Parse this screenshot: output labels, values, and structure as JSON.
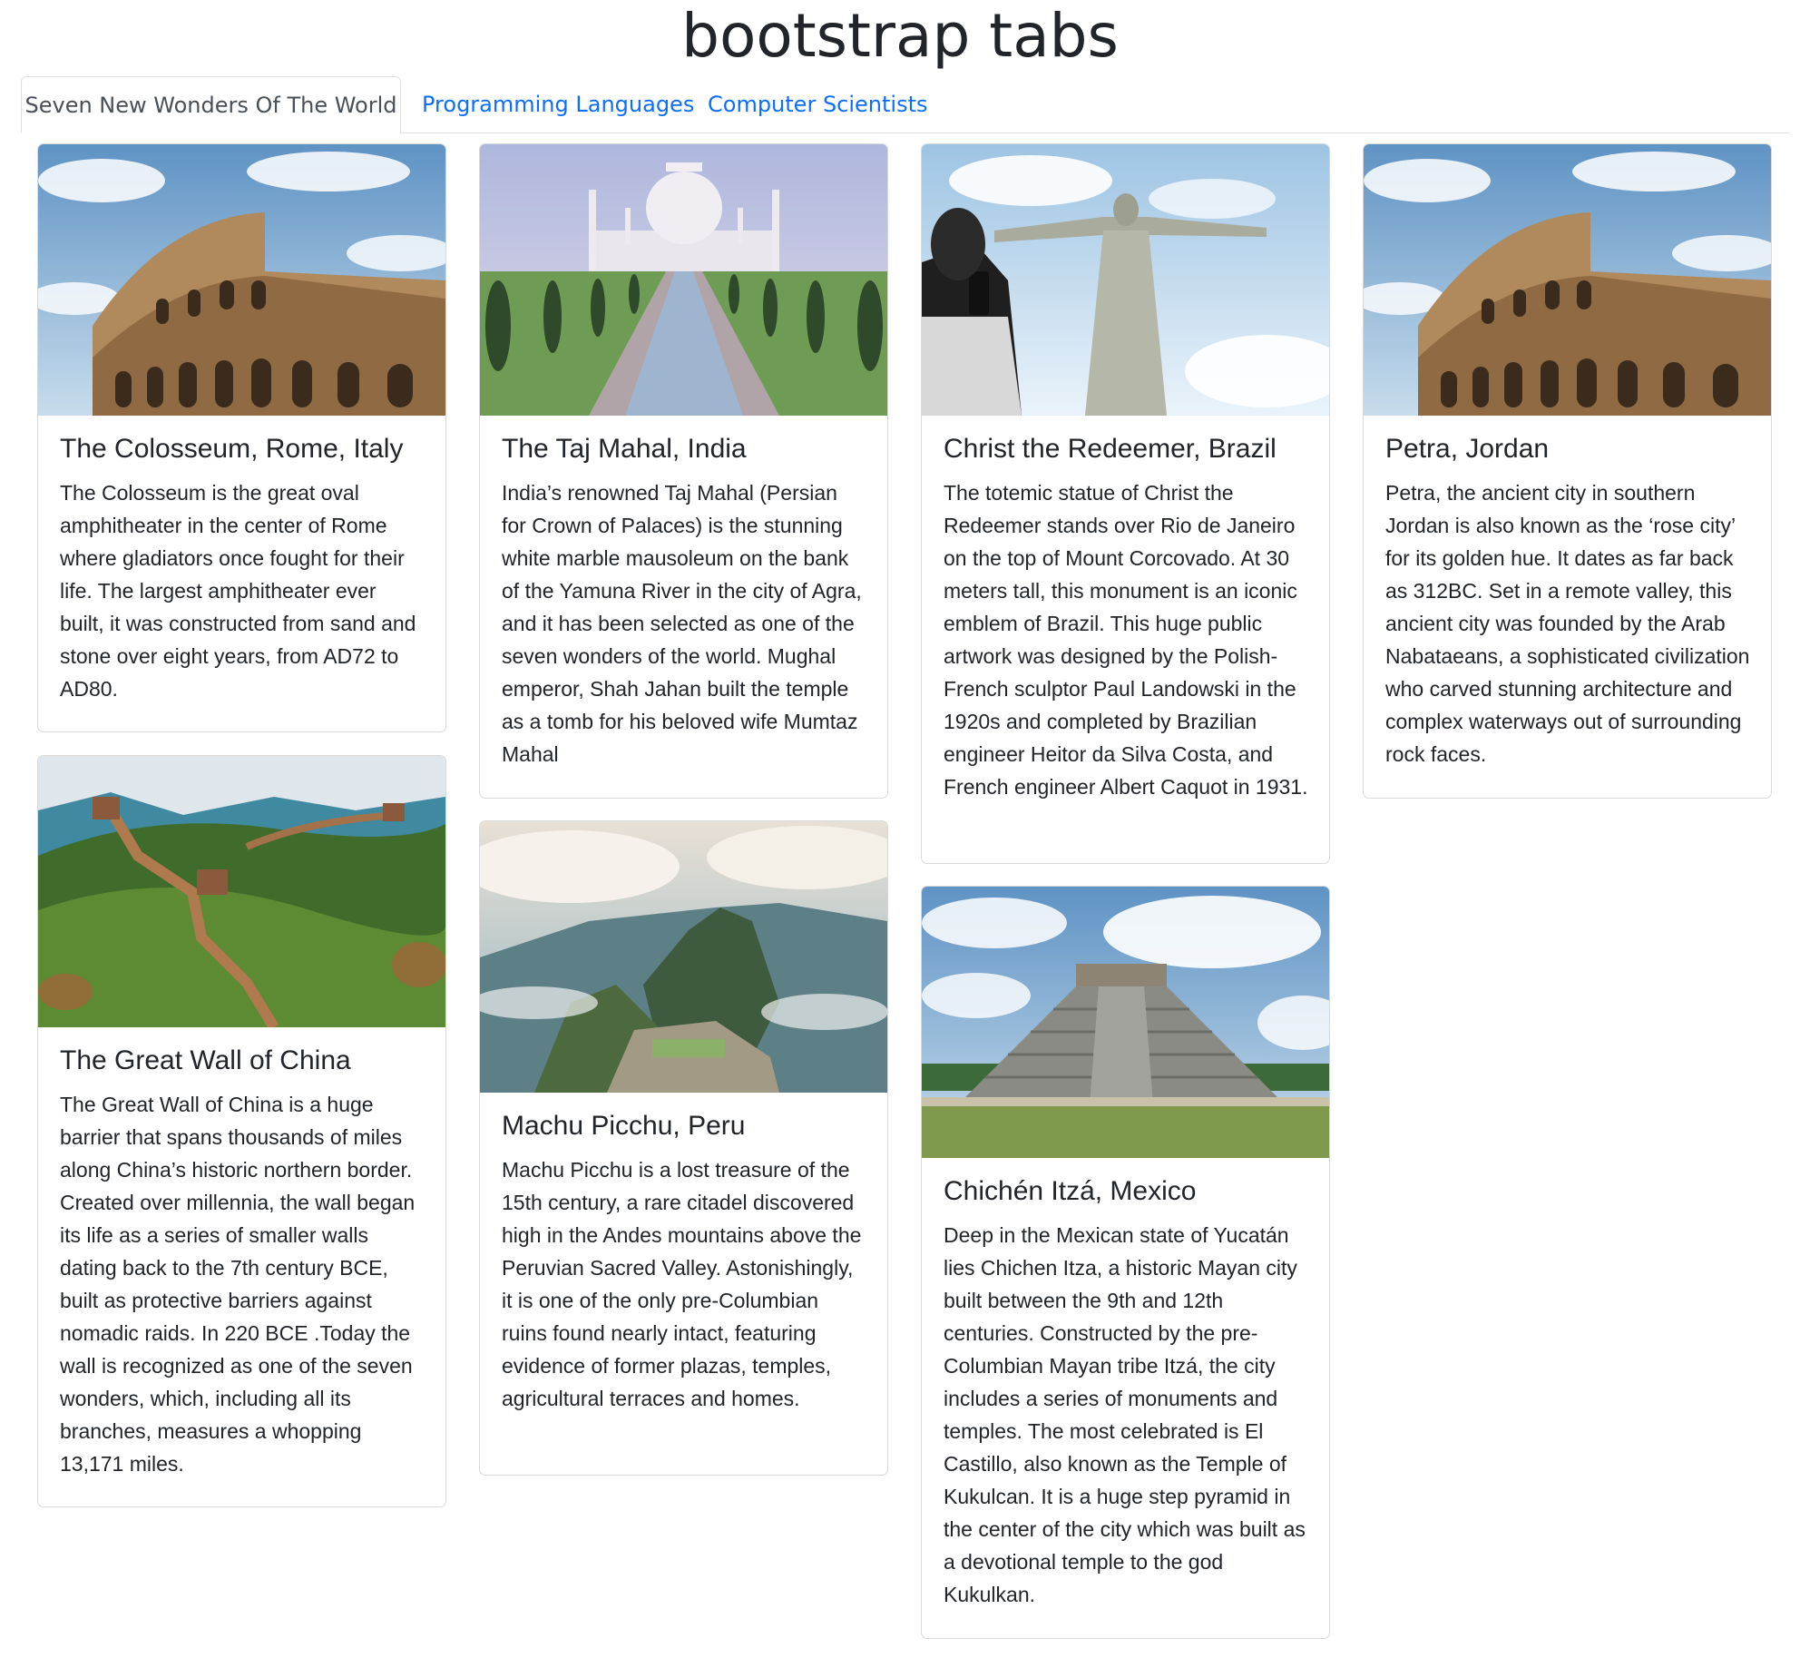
{
  "page": {
    "title": "bootstrap tabs"
  },
  "tabs": [
    {
      "label": "Seven New Wonders Of The World",
      "active": true
    },
    {
      "label": "Programming Languages",
      "active": false
    },
    {
      "label": "Computer Scientists",
      "active": false
    }
  ],
  "cards": [
    {
      "image_icon": "colosseum-photo",
      "title": "The Colosseum, Rome, Italy",
      "text": "The Colosseum is the great oval amphitheater in the center of Rome where gladiators once fought for their life. The largest amphitheater ever built, it was constructed from sand and stone over eight years, from AD72 to AD80."
    },
    {
      "image_icon": "taj-mahal-photo",
      "title": "The Taj Mahal, India",
      "text": "India’s renowned Taj Mahal (Persian for Crown of Palaces) is the stunning white marble mausoleum on the bank of the Yamuna River in the city of Agra, and it has been selected as one of the seven wonders of the world. Mughal emperor, Shah Jahan built the temple as a tomb for his beloved wife Mumtaz Mahal"
    },
    {
      "image_icon": "christ-the-redeemer-photo",
      "title": "Christ the Redeemer, Brazil",
      "text": "The totemic statue of Christ the Redeemer stands over Rio de Janeiro on the top of Mount Corcovado. At 30 meters tall, this monument is an iconic emblem of Brazil. This huge public artwork was designed by the Polish-French sculptor Paul Landowski in the 1920s and completed by Brazilian engineer Heitor da Silva Costa, and French engineer Albert Caquot in 1931."
    },
    {
      "image_icon": "colosseum-photo",
      "title": "Petra, Jordan",
      "text": "Petra, the ancient city in southern Jordan is also known as the ‘rose city’ for its golden hue. It dates as far back as 312BC. Set in a remote valley, this ancient city was founded by the Arab Nabataeans, a sophisticated civilization who carved stunning architecture and complex waterways out of surrounding rock faces."
    },
    {
      "image_icon": "great-wall-photo",
      "title": "The Great Wall of China",
      "text": "The Great Wall of China is a huge barrier that spans thousands of miles along China’s historic northern border. Created over millennia, the wall began its life as a series of smaller walls dating back to the 7th century BCE, built as protective barriers against nomadic raids. In 220 BCE .Today the wall is recognized as one of the seven wonders, which, including all its branches, measures a whopping 13,171 miles."
    },
    {
      "image_icon": "machu-picchu-photo",
      "title": "Machu Picchu, Peru",
      "text": "Machu Picchu is a lost treasure of the 15th century, a rare citadel discovered high in the Andes mountains above the Peruvian Sacred Valley. Astonishingly, it is one of the only pre-Columbian ruins found nearly intact, featuring evidence of former plazas, temples, agricultural terraces and homes."
    },
    {
      "image_icon": "chichen-itza-photo",
      "title": "Chichén Itzá, Mexico",
      "text": "Deep in the Mexican state of Yucatán lies Chichen Itza, a historic Mayan city built between the 9th and 12th centuries. Constructed by the pre-Columbian Mayan tribe Itzá, the city includes a series of monuments and temples. The most celebrated is El Castillo, also known as the Temple of Kukulcan. It is a huge step pyramid in the center of the city which was built as a devotional temple to the god Kukulkan."
    }
  ],
  "colors": {
    "link": "#0d6efd",
    "text": "#212529",
    "border": "#dee2e6"
  }
}
